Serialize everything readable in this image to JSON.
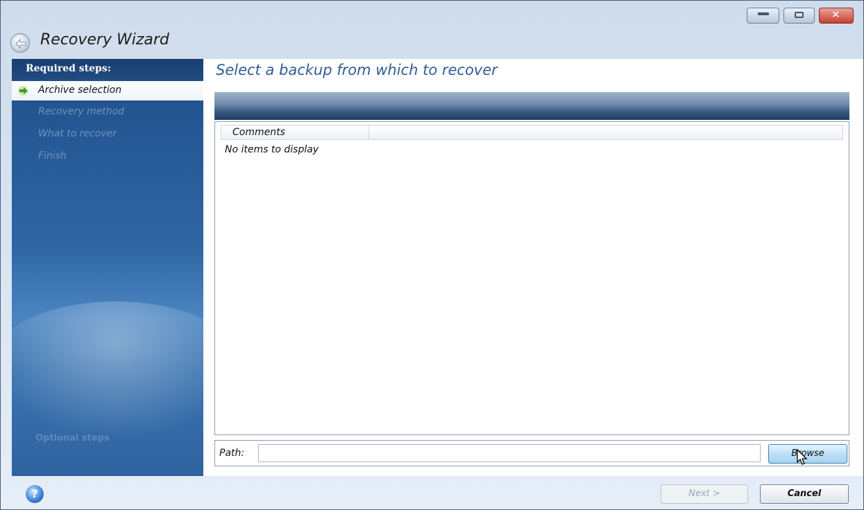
{
  "window": {
    "title": "Recovery Wizard"
  },
  "sidebar": {
    "required_heading": "Required steps:",
    "steps": [
      {
        "label": "Archive selection",
        "active": true
      },
      {
        "label": "Recovery method",
        "active": false
      },
      {
        "label": "What to recover",
        "active": false
      },
      {
        "label": "Finish",
        "active": false
      }
    ],
    "optional_heading": "Optional steps"
  },
  "main": {
    "heading": "Select a backup from which to recover",
    "list": {
      "columns": [
        "Comments"
      ],
      "empty_text": "No items to display"
    },
    "path": {
      "label": "Path:",
      "value": ""
    },
    "browse_label": "Browse"
  },
  "footer": {
    "help_symbol": "?",
    "next_label": "Next >",
    "cancel_label": "Cancel"
  },
  "colors": {
    "sidebar_blue": "#2f66a3",
    "heading_blue": "#2f5d95",
    "close_red": "#c7402f"
  }
}
